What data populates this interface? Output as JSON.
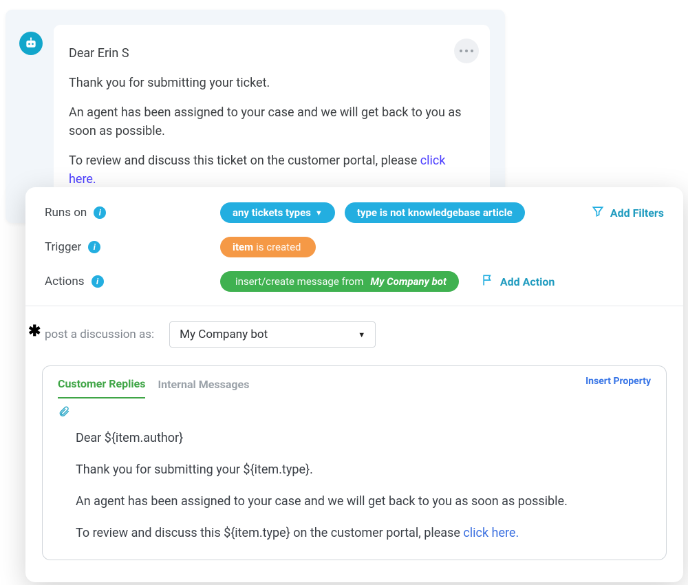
{
  "message": {
    "greeting": "Dear Erin S",
    "para2": "Thank you for submitting your ticket.",
    "para3": "An agent has been assigned to your case and we will get back to you as soon as possible.",
    "para4_prefix": "To review and discuss this ticket on the customer portal, please ",
    "para4_link": "click here.",
    "more_icon": "more-horizontal"
  },
  "rules": {
    "runs_on_label": "Runs on",
    "trigger_label": "Trigger",
    "actions_label": "Actions",
    "pill_any_types": "any tickets types",
    "pill_type_not_kb": "type is not knowledgebase article",
    "trigger_item": "item",
    "trigger_is_created": "is created",
    "action_prefix": "insert/create message from",
    "action_bot": "My Company bot",
    "add_filters": "Add Filters",
    "add_action": "Add Action"
  },
  "post": {
    "label": "post a discussion as:",
    "selected": "My Company bot"
  },
  "editor": {
    "tabs": {
      "replies": "Customer Replies",
      "internal": "Internal Messages"
    },
    "insert_property": "Insert Property",
    "body": {
      "p1": "Dear ${item.author}",
      "p2": "Thank you for submitting your ${item.type}.",
      "p3": "An agent has been assigned to your case and we will get back to you as soon as possible.",
      "p4_prefix": "To review and discuss this ${item.type} on the customer portal, please ",
      "p4_link": "click here."
    }
  }
}
